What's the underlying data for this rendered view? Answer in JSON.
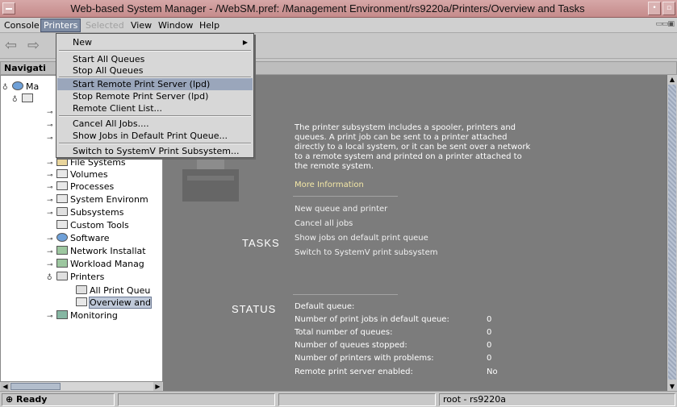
{
  "window": {
    "title": "Web-based System Manager - /WebSM.pref: /Management Environment/rs9220a/Printers/Overview and Tasks"
  },
  "menubar": {
    "items": [
      "Console",
      "Printers",
      "Selected",
      "View",
      "Window",
      "Help"
    ],
    "active": "Printers",
    "disabled": "Selected"
  },
  "headers": {
    "navigation": "Navigati",
    "content": "y and Tasks"
  },
  "printers_menu": {
    "items": [
      {
        "label": "New",
        "has_submenu": true
      },
      {
        "label": "Start All Queues"
      },
      {
        "label": "Stop All Queues"
      },
      {
        "label": "Start Remote Print Server (lpd)",
        "highlighted": true
      },
      {
        "label": "Stop Remote Print Server (lpd)"
      },
      {
        "label": "Remote Client List..."
      },
      {
        "label": "Cancel All Jobs...."
      },
      {
        "label": "Show Jobs in Default Print Queue..."
      },
      {
        "label": "Switch to SystemV Print Subsystem..."
      }
    ]
  },
  "nav_tree": {
    "items": [
      {
        "label": "Ma"
      },
      {
        "label": ""
      },
      {
        "label": "File Systems"
      },
      {
        "label": "Volumes"
      },
      {
        "label": "Processes"
      },
      {
        "label": "System Environm"
      },
      {
        "label": "Subsystems"
      },
      {
        "label": "Custom Tools"
      },
      {
        "label": "Software"
      },
      {
        "label": "Network Installat"
      },
      {
        "label": "Workload Manag"
      },
      {
        "label": "Printers"
      },
      {
        "label": "All Print Queu"
      },
      {
        "label": "Overview and"
      },
      {
        "label": "Monitoring"
      }
    ]
  },
  "content": {
    "title": "ters",
    "description": "The printer subsystem includes a spooler, printers and queues. A print job can be sent to a printer attached directly to a local system, or it can be sent over a network to a remote system and printed on a printer attached to the remote system.",
    "more_info": "More Information",
    "tasks_label": "TASKS",
    "tasks": [
      "New queue and printer",
      "Cancel all jobs",
      "Show jobs on default print queue",
      "Switch to SystemV print subsystem"
    ],
    "status_label": "STATUS",
    "status": [
      {
        "label": "Default queue:",
        "value": ""
      },
      {
        "label": "Number of print jobs in default queue:",
        "value": "0"
      },
      {
        "label": "Total number of queues:",
        "value": "0"
      },
      {
        "label": "Number of queues stopped:",
        "value": "0"
      },
      {
        "label": "Number of printers with problems:",
        "value": "0"
      },
      {
        "label": "Remote print server enabled:",
        "value": "No"
      }
    ]
  },
  "statusbar": {
    "state": "Ready",
    "user": "root - rs9220a"
  },
  "colors": {
    "titlebar": "#c58b8b",
    "content_bg": "#7c7c7c",
    "menu_highlight": "#9aa6bb"
  }
}
